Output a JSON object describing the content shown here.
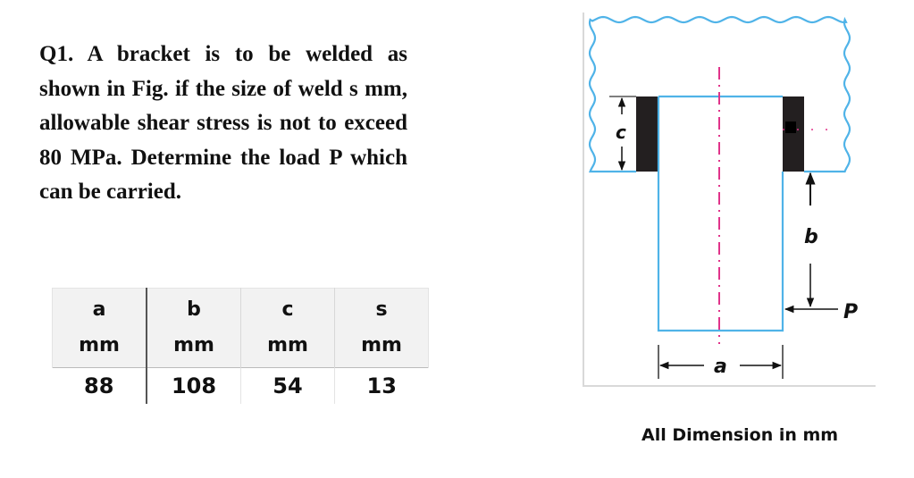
{
  "question": {
    "text": "Q1. A bracket is to be welded as shown in Fig. if the size of weld s mm, allowable shear stress is not to exceed 80 MPa. Determine the load P which can be carried."
  },
  "table": {
    "headers": [
      {
        "symbol": "a",
        "unit": "mm"
      },
      {
        "symbol": "b",
        "unit": "mm"
      },
      {
        "symbol": "c",
        "unit": "mm"
      },
      {
        "symbol": "s",
        "unit": "mm"
      }
    ],
    "values": [
      "88",
      "108",
      "54",
      "13"
    ]
  },
  "figure": {
    "labels": {
      "c": "c",
      "b": "b",
      "a": "a",
      "P": "P"
    },
    "colors": {
      "outline": "#4fb3e8",
      "weld": "#231f20",
      "centerline": "#e0338a",
      "dimension": "#111111",
      "frame": "#d9d9d9"
    },
    "note": "All Dimension in mm"
  }
}
